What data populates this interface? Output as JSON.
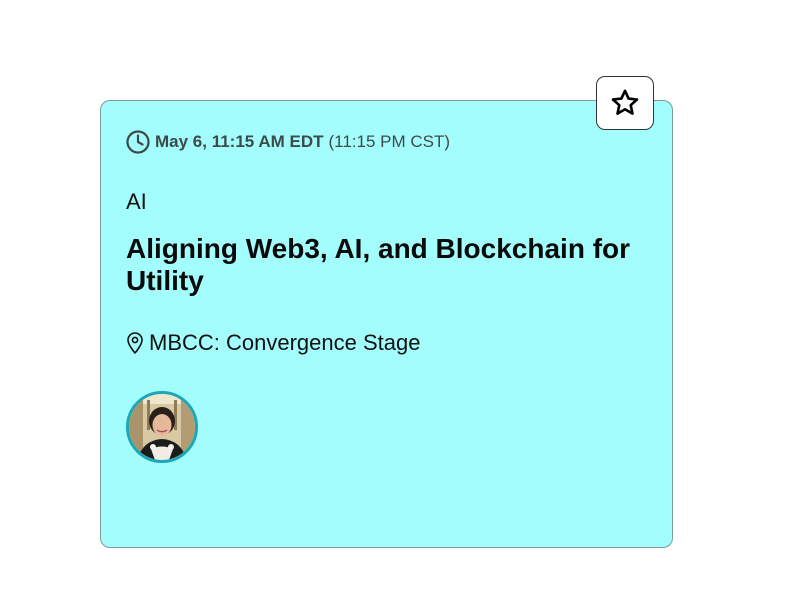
{
  "session": {
    "time_main": "May 6, 11:15 AM EDT",
    "time_alt": "(11:15 PM CST)",
    "track": "AI",
    "title": "Aligning Web3, AI, and Blockchain for Utility",
    "location": "MBCC: Convergence Stage"
  },
  "icons": {
    "time": "clock-icon",
    "location": "map-pin-icon",
    "favorite": "star-outline-icon"
  },
  "colors": {
    "card_background": "#a3fdfd",
    "avatar_ring": "#1aa7b7"
  }
}
